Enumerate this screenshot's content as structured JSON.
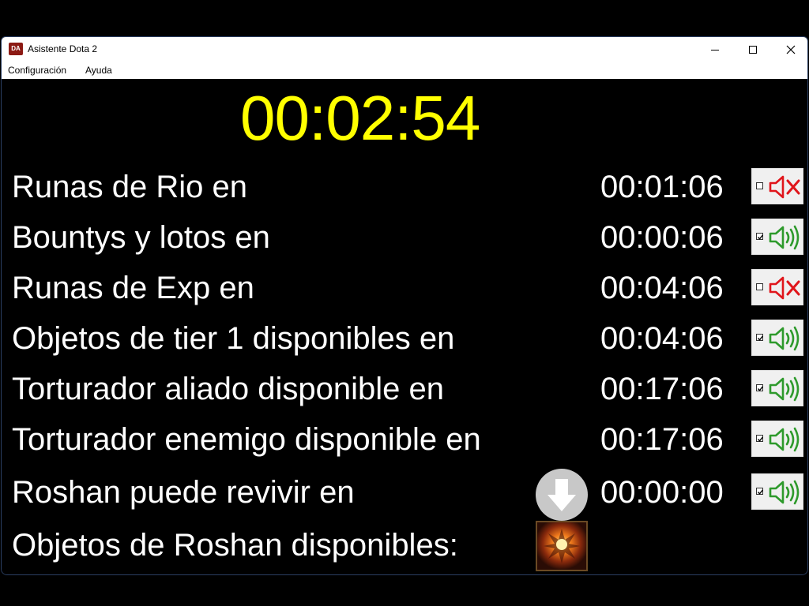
{
  "window": {
    "icon_text": "DA",
    "title": "Asistente Dota 2"
  },
  "menu": [
    "Configuración",
    "Ayuda"
  ],
  "main_timer": "00:02:54",
  "rows": [
    {
      "label": "Runas de Rio en",
      "time": "00:01:06",
      "sound_enabled": false
    },
    {
      "label": "Bountys y lotos en",
      "time": "00:00:06",
      "sound_enabled": true
    },
    {
      "label": "Runas de Exp en",
      "time": "00:04:06",
      "sound_enabled": false
    },
    {
      "label": "Objetos de tier 1 disponibles en",
      "time": "00:04:06",
      "sound_enabled": true
    },
    {
      "label": "Torturador aliado disponible en",
      "time": "00:17:06",
      "sound_enabled": true
    },
    {
      "label": "Torturador enemigo disponible en",
      "time": "00:17:06",
      "sound_enabled": true
    },
    {
      "label": "Roshan puede revivir en",
      "time": "00:00:00",
      "sound_enabled": true
    }
  ],
  "roshan_items_label": "Objetos de Roshan disponibles:",
  "icons": {
    "muted": "speaker-muted-icon",
    "unmuted": "speaker-on-icon",
    "arrow": "down-arrow-icon",
    "roshan_item": "roshan-item-icon"
  },
  "colors": {
    "timer": "#ffff00",
    "muted": "#e0151b",
    "unmuted": "#2e9a2c"
  }
}
